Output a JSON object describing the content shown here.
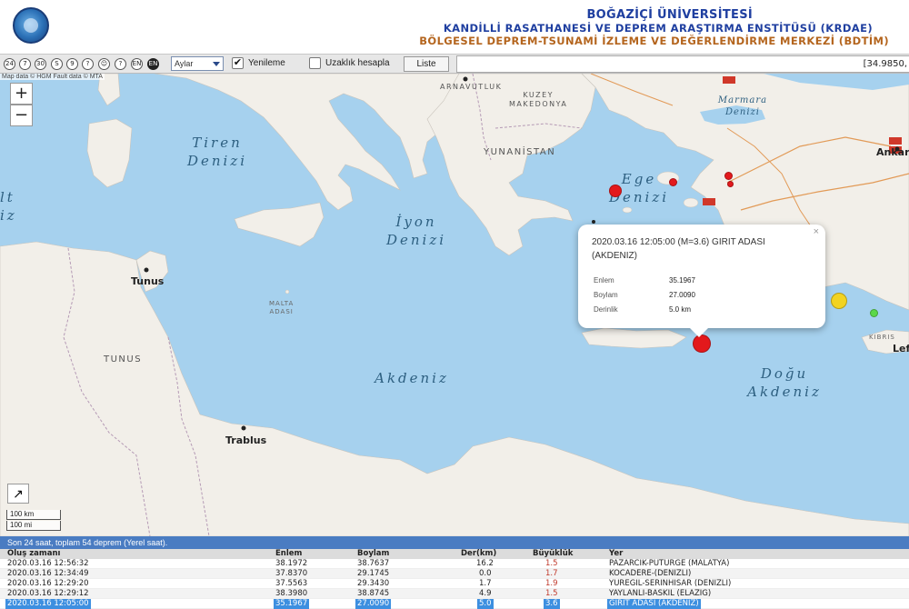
{
  "header": {
    "title": "BOĞAZİÇİ ÜNİVERSİTESİ",
    "subtitle": "KANDİLLİ RASATHANESİ VE DEPREM ARAŞTIRMA ENSTİTÜSÜ (KRDAE)",
    "department": "BÖLGESEL DEPREM-TSUNAMİ İZLEME VE DEĞERLENDİRME MERKEZİ (BDTİM)"
  },
  "toolbar": {
    "icons": [
      "24",
      "7",
      "30",
      "S",
      "9",
      "?",
      "☺",
      "?",
      "EN"
    ],
    "period_value": "Aylar",
    "refresh_label": "Yenileme",
    "refresh_checked": true,
    "distance_label": "Uzaklık hesapla",
    "distance_checked": false,
    "list_button": "Liste",
    "coordinate": "[34.9850,"
  },
  "map": {
    "attribution": "Map data © HGM Fault data © MTA",
    "zoom_in": "+",
    "zoom_out": "−",
    "fullscreen_icon": "↗",
    "scale_km": "100 km",
    "scale_mi": "100 mi",
    "labels": {
      "tiren": "Tiren\nDenizi",
      "iyon": "İyon\nDenizi",
      "ege": "Ege\nDenizi",
      "akdeniz": "Akdeniz",
      "dogu": "Doğu\nAkdeniz",
      "marmara": "Marmara\nDenizi",
      "left_partial": "lt\niz",
      "yunanistan": "YUNANİSTAN",
      "arnavutluk": "ARNAVUTLUK",
      "kuzey_makedonya": "KUZEY\nMAKEDONYA",
      "tunus_country": "TUNUS",
      "tunus_city": "Tunus",
      "trablus": "Trablus",
      "ankara": "Ankara",
      "malta": "MALTA\nADASI",
      "lefkosa_partial": "Lef",
      "kibris_partial": "KIBRIS"
    },
    "quakes": [
      {
        "color": "#e3191c"
      },
      {
        "color": "#e3191c"
      },
      {
        "color": "#e3191c"
      },
      {
        "color": "#e3191c"
      },
      {
        "color": "#e3191c"
      },
      {
        "color": "#f2d322"
      },
      {
        "color": "#5bd84a"
      }
    ]
  },
  "popup": {
    "title": "2020.03.16 12:05:00 (M=3.6) GIRIT ADASI (AKDENIZ)",
    "close": "×",
    "lat_label": "Enlem",
    "lat_value": "35.1967",
    "lon_label": "Boylam",
    "lon_value": "27.0090",
    "depth_label": "Derinlik",
    "depth_value": "5.0 km"
  },
  "summary": "Son 24 saat, toplam 54 deprem (Yerel saat).",
  "table": {
    "headers": {
      "time": "Oluş zamanı",
      "lat": "Enlem",
      "lon": "Boylam",
      "depth": "Der(km)",
      "mag": "Büyüklük",
      "place": "Yer"
    },
    "rows": [
      {
        "time": "2020.03.16 12:56:32",
        "lat": "38.1972",
        "lon": "38.7637",
        "depth": "16.2",
        "mag": "1.5",
        "place": "PAZARCIK-PUTURGE (MALATYA)"
      },
      {
        "time": "2020.03.16 12:34:49",
        "lat": "37.8370",
        "lon": "29.1745",
        "depth": "0.0",
        "mag": "1.7",
        "place": "KOCADERE-(DENIZLI)"
      },
      {
        "time": "2020.03.16 12:29:20",
        "lat": "37.5563",
        "lon": "29.3430",
        "depth": "1.7",
        "mag": "1.9",
        "place": "YUREGIL-SERINHISAR (DENIZLI)"
      },
      {
        "time": "2020.03.16 12:29:12",
        "lat": "38.3980",
        "lon": "38.8745",
        "depth": "4.9",
        "mag": "1.5",
        "place": "YAYLANLI-BASKIL (ELAZIG)"
      },
      {
        "time": "2020.03.16 12:05:00",
        "lat": "35.1967",
        "lon": "27.0090",
        "depth": "5.0",
        "mag": "3.6",
        "place": "GIRIT ADASI (AKDENIZ)"
      }
    ]
  }
}
